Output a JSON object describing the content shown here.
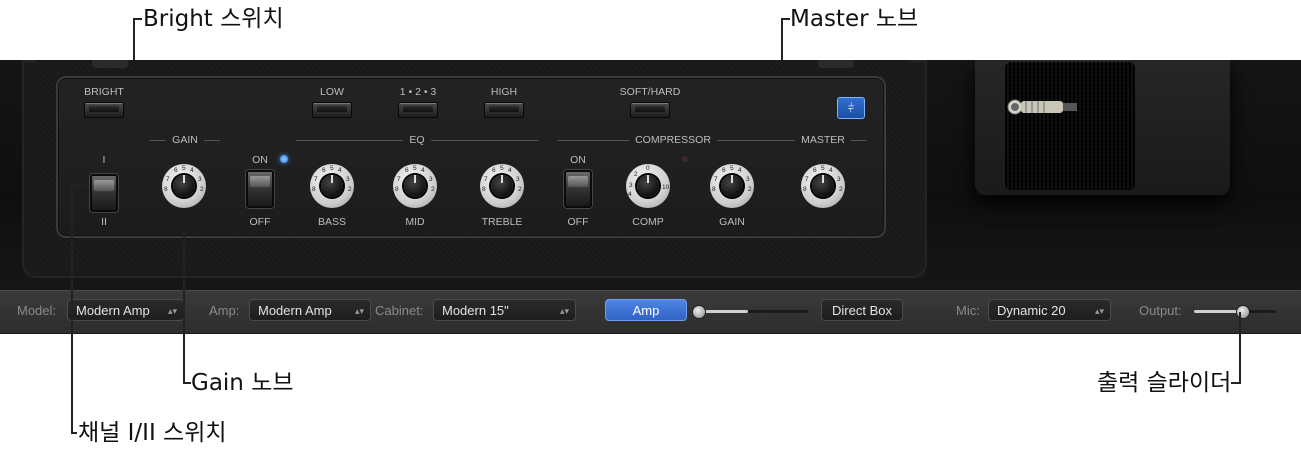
{
  "callouts": {
    "bright_switch": "Bright 스위치",
    "master_knob": "Master 노브",
    "gain_knob": "Gain 노브",
    "output_slider": "출력 슬라이더",
    "channel_switch": "채널 I/II 스위치"
  },
  "panel": {
    "bright": "BRIGHT",
    "low": "LOW",
    "mode": "1 • 2 • 3",
    "high": "HIGH",
    "soft_hard": "SOFT/HARD",
    "gain_section": "GAIN",
    "eq_section": "EQ",
    "compressor_section": "COMPRESSOR",
    "master_section": "MASTER",
    "channel_i": "I",
    "channel_ii": "II",
    "on": "ON",
    "off": "OFF",
    "bass": "BASS",
    "mid": "MID",
    "treble": "TREBLE",
    "comp": "COMP",
    "gain": "GAIN",
    "eq_icon": "equalizer-icon"
  },
  "bottom": {
    "model_label": "Model:",
    "model_value": "Modern Amp",
    "amp_label": "Amp:",
    "amp_value": "Modern Amp",
    "cabinet_label": "Cabinet:",
    "cabinet_value": "Modern 15\"",
    "amp_button": "Amp",
    "blend_level": 0.45,
    "direct_box_button": "Direct Box",
    "mic_label": "Mic:",
    "mic_value": "Dynamic 20",
    "output_label": "Output:",
    "output_level": 0.58
  },
  "colors": {
    "accent": "#3d74d8",
    "led": "#3a8fe8"
  }
}
